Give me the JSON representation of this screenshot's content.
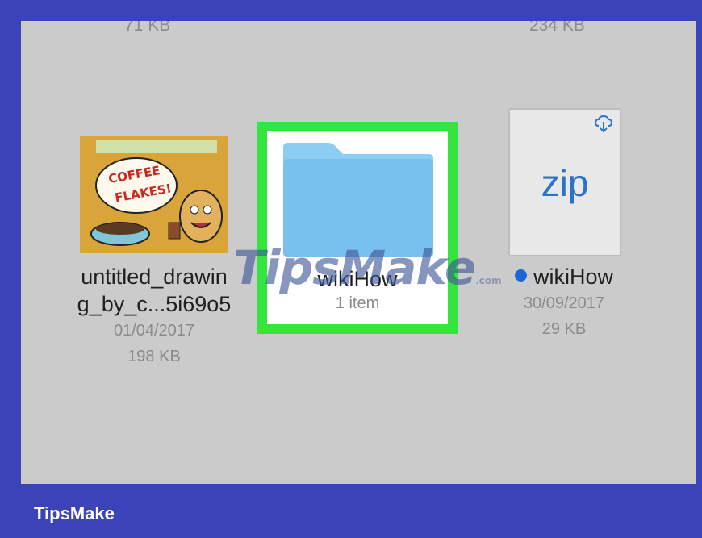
{
  "top_row": {
    "left_size": "71 KB",
    "right_size": "234 KB"
  },
  "files": [
    {
      "name_line1": "untitled_drawin",
      "name_line2": "g_by_c...5i69o5",
      "date": "01/04/2017",
      "size": "198 KB",
      "thumbnail_text": [
        "COFFEE",
        "FLAKES!"
      ]
    },
    {
      "name": "wikiHow",
      "subtitle": "1 item",
      "icon": "folder-icon",
      "selected": true
    },
    {
      "badge_text": "zip",
      "name": "wikiHow",
      "date": "30/09/2017",
      "size": "29 KB",
      "icon": "cloud-download-icon",
      "unread_dot": true
    }
  ],
  "watermark": {
    "text": "TipsMake",
    "suffix": ".com"
  },
  "footer": {
    "brand": "TipsMake"
  },
  "colors": {
    "frame": "#3a44b8",
    "highlight": "#34e43f",
    "folder": "#7cc3f0",
    "zip_text": "#2c73c4",
    "dot": "#1a66d6"
  }
}
